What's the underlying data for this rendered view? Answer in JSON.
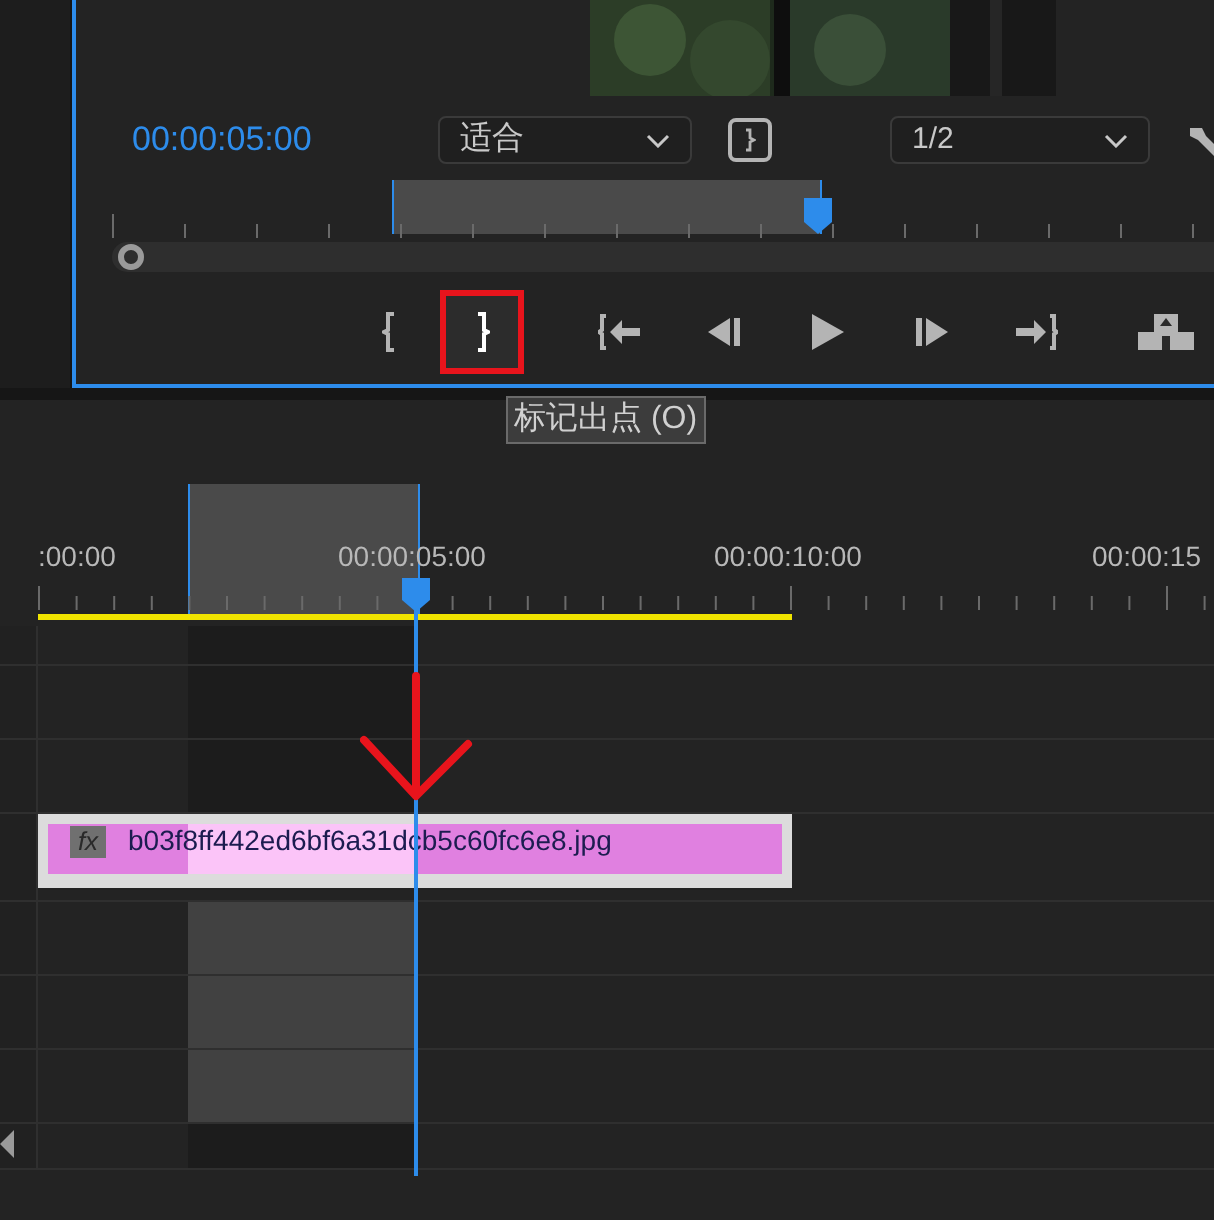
{
  "source_monitor": {
    "timecode": "00:00:05:00",
    "zoom_dropdown": {
      "value": "适合"
    },
    "resolution_dropdown": {
      "value": "1/2"
    },
    "transport_buttons": [
      {
        "kind": "mark-in",
        "annotated": false
      },
      {
        "kind": "mark-out",
        "annotated": true
      },
      {
        "kind": "go-to-in",
        "annotated": false
      },
      {
        "kind": "step-back",
        "annotated": false
      },
      {
        "kind": "play",
        "annotated": false
      },
      {
        "kind": "step-forward",
        "annotated": false
      },
      {
        "kind": "go-to-out",
        "annotated": false
      },
      {
        "kind": "export-frame",
        "annotated": false
      }
    ]
  },
  "tooltip": "标记出点 (O)",
  "timeline": {
    "ruler_labels": [
      ":00:00",
      "00:00:05:00",
      "00:00:10:00",
      "00:00:15"
    ],
    "clip": {
      "badge": "fx",
      "name": "b03f8ff442ed6bf6a31dcb5c60fc6e8.jpg"
    }
  }
}
